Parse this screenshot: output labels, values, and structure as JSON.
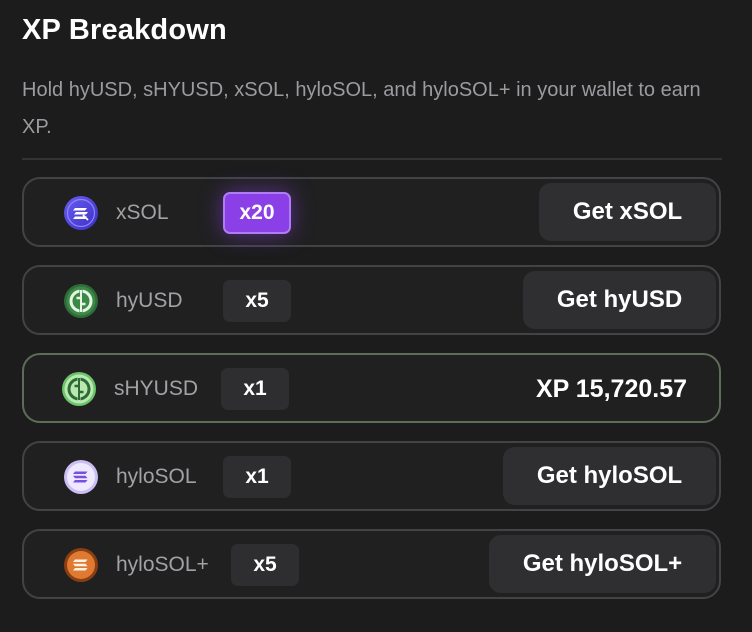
{
  "header": {
    "title": "XP Breakdown",
    "subtitle": "Hold hyUSD, sHYUSD, xSOL, hyloSOL, and hyloSOL+ in your wallet to earn XP."
  },
  "rows": [
    {
      "icon": "xsol-icon",
      "token": "xSOL",
      "multiplier": "x20",
      "button": "Get xSOL"
    },
    {
      "icon": "hyusd-icon",
      "token": "hyUSD",
      "multiplier": "x5",
      "button": "Get hyUSD"
    },
    {
      "icon": "shyusd-icon",
      "token": "sHYUSD",
      "multiplier": "x1",
      "xp": "XP 15,720.57"
    },
    {
      "icon": "hylosol-icon",
      "token": "hyloSOL",
      "multiplier": "x1",
      "button": "Get hyloSOL"
    },
    {
      "icon": "hylosol-plus-icon",
      "token": "hyloSOL+",
      "multiplier": "x5",
      "button": "Get hyloSOL+"
    }
  ],
  "colors": {
    "accent_purple": "#8b3fe6",
    "active_border": "#5d6d58",
    "background": "#1c1c1d"
  }
}
